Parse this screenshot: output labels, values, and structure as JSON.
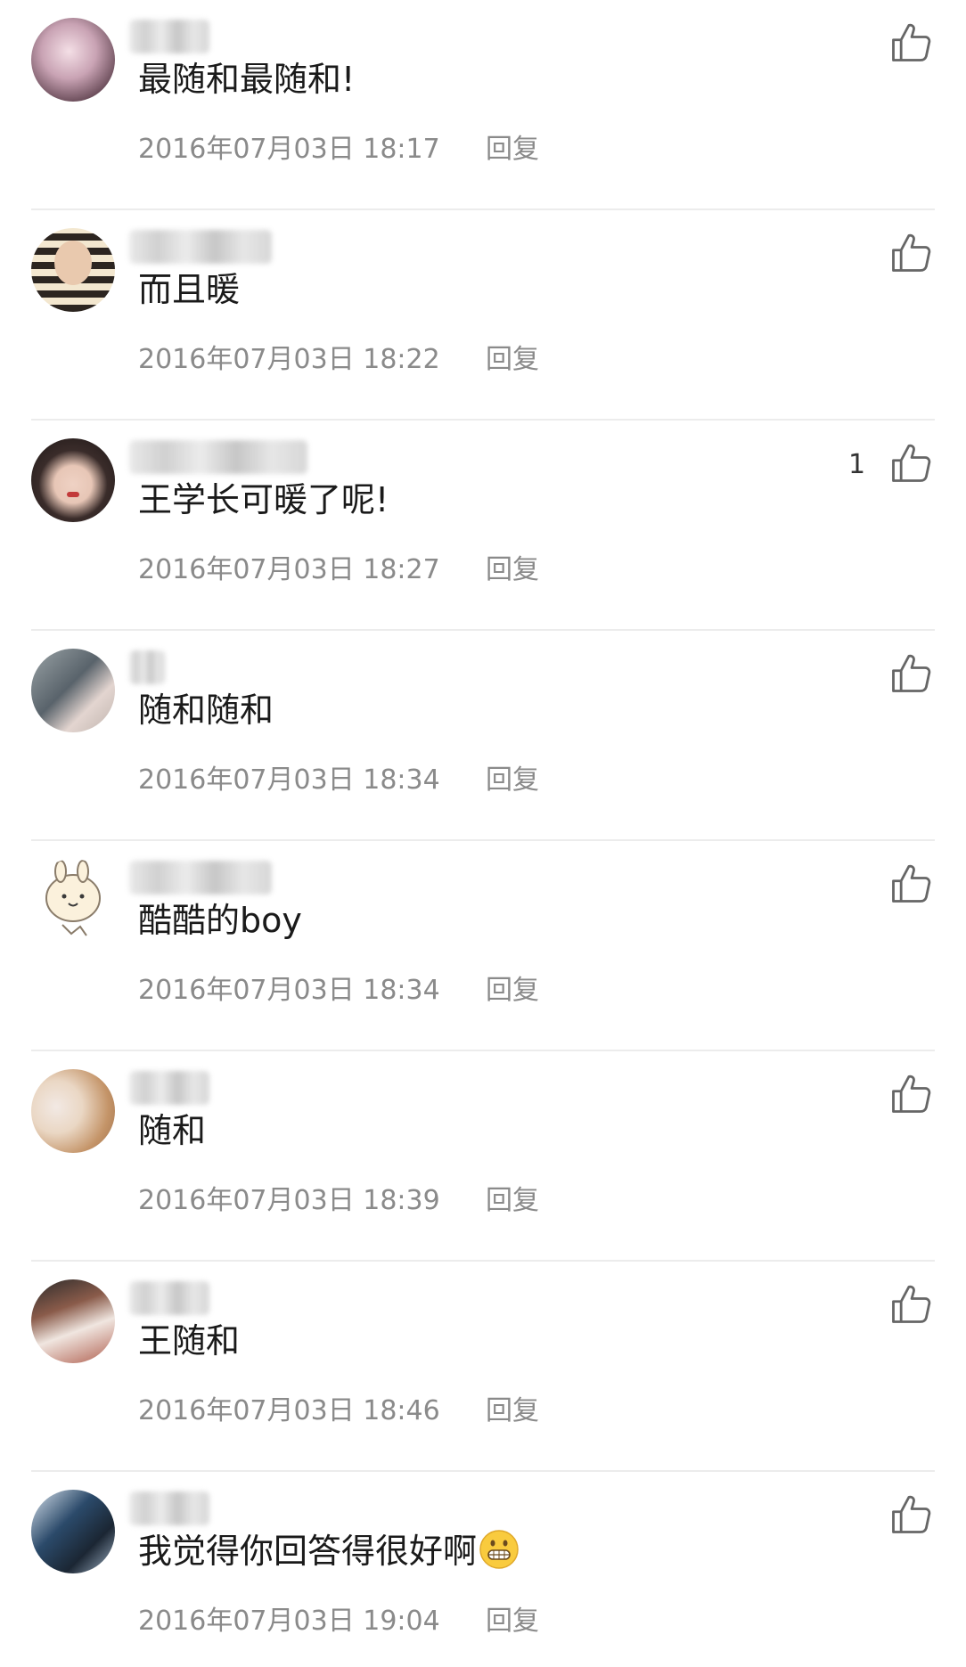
{
  "comments": [
    {
      "text": "最随和最随和!",
      "timestamp": "2016年07月03日 18:17",
      "reply": "回复",
      "likes": "",
      "avatar_colors": [
        "#e8c9d3",
        "#6b4d5a",
        "#a8c4d8"
      ]
    },
    {
      "text": "而且暖",
      "timestamp": "2016年07月03日 18:22",
      "reply": "回复",
      "likes": "",
      "avatar_colors": [
        "#f3e7cf",
        "#2c2520",
        "#d9a65b"
      ]
    },
    {
      "text": "王学长可暖了呢!",
      "timestamp": "2016年07月03日 18:27",
      "reply": "回复",
      "likes": "1",
      "avatar_colors": [
        "#3a2c2a",
        "#e7c6b6",
        "#c23a3a"
      ]
    },
    {
      "text": "随和随和",
      "timestamp": "2016年07月03日 18:34",
      "reply": "回复",
      "likes": "",
      "avatar_colors": [
        "#59636b",
        "#e3d5d0",
        "#9aa3a6"
      ]
    },
    {
      "text": "酷酷的boy",
      "timestamp": "2016年07月03日 18:34",
      "reply": "回复",
      "likes": "",
      "avatar_colors": [
        "#ffffff",
        "#f1e2c0",
        "#8a7c6a"
      ]
    },
    {
      "text": "随和",
      "timestamp": "2016年07月03日 18:39",
      "reply": "回复",
      "likes": "",
      "avatar_colors": [
        "#ead7c4",
        "#c49468",
        "#f2e9e4"
      ]
    },
    {
      "text": "王随和",
      "timestamp": "2016年07月03日 18:46",
      "reply": "回复",
      "likes": "",
      "avatar_colors": [
        "#8a5b4a",
        "#f0e6e0",
        "#2b2b2b"
      ]
    },
    {
      "text": "我觉得你回答得很好啊",
      "timestamp": "2016年07月03日 19:04",
      "reply": "回复",
      "likes": "",
      "avatar_colors": [
        "#2b4a6a",
        "#d8e2ec",
        "#1b2633"
      ],
      "emoji": "grinning-face-emoji"
    }
  ],
  "colors": {
    "text_primary": "#1a1a1a",
    "text_secondary": "#8a8a8a",
    "divider": "#ececec",
    "like_icon": "#666666"
  }
}
